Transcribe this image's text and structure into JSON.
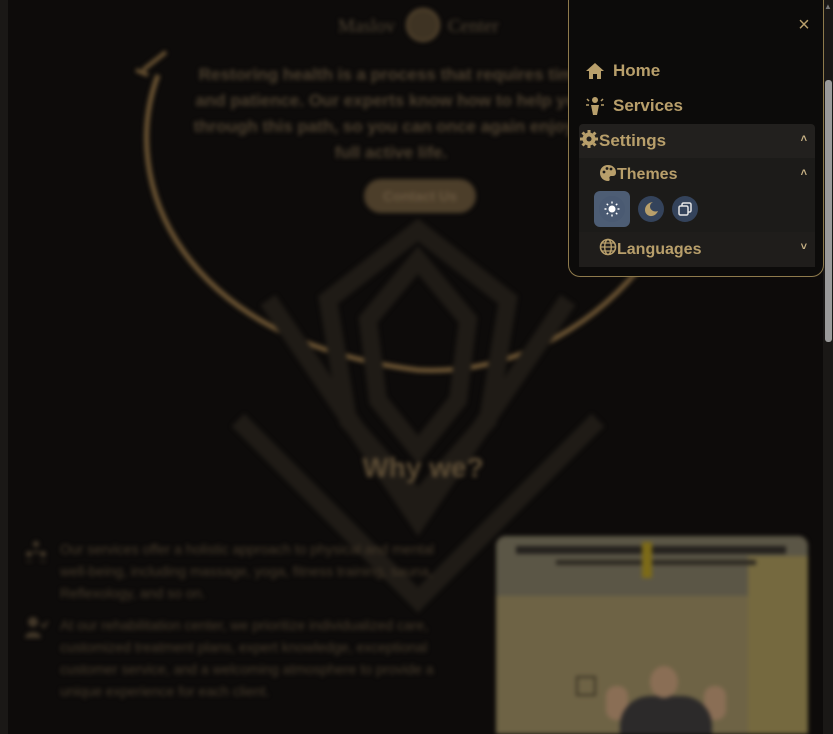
{
  "background": {
    "brand": {
      "left": "Maslov",
      "right": "Center"
    },
    "hero_text": "Restoring health is a process that requires time and patience. Our experts know how to help you through this path, so you can once again enjoy a full active life.",
    "cta_label": "Contact Us",
    "why_title": "Why we?",
    "features": [
      {
        "icon": "people-icon",
        "text": "Our services offer a holistic approach to physical and mental well-being, including massage, yoga, fitness training, sauna, Reflexology, and so on."
      },
      {
        "icon": "person-check-icon",
        "text": "At our rehabilitation center, we prioritize individualized care, customized treatment plans, expert knowledge, exceptional customer service, and a welcoming atmosphere to provide a unique experience for each client."
      }
    ]
  },
  "menu": {
    "close_label": "×",
    "items": [
      {
        "label": "Home",
        "icon": "home-icon"
      },
      {
        "label": "Services",
        "icon": "services-icon"
      }
    ],
    "settings": {
      "label": "Settings",
      "icon": "gear-icon",
      "themes": {
        "label": "Themes",
        "icon": "palette-icon",
        "options": [
          {
            "name": "light",
            "icon": "sun-icon",
            "active": true
          },
          {
            "name": "dark",
            "icon": "moon-icon",
            "active": false
          },
          {
            "name": "system",
            "icon": "system-theme-icon",
            "active": false
          }
        ]
      },
      "languages": {
        "label": "Languages",
        "icon": "globe-icon"
      }
    }
  },
  "colors": {
    "accent": "#b89f6b",
    "border": "#8e7a4c",
    "panel": "#22201e",
    "theme_button": "#34435b"
  }
}
